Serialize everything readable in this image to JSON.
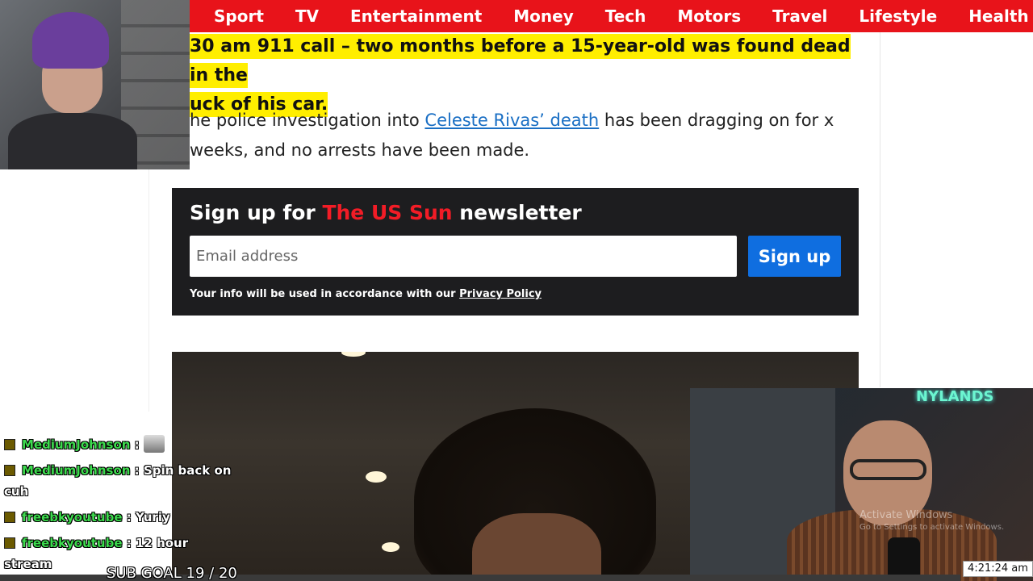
{
  "nav": {
    "items": [
      "Sport",
      "TV",
      "Entertainment",
      "Money",
      "Tech",
      "Motors",
      "Travel",
      "Lifestyle",
      "Health"
    ]
  },
  "article": {
    "highlight_line1": "30 am 911 call – two months before a 15-year-old was found dead in the",
    "highlight_line2": "uck of his car.",
    "para_before": "he police investigation into ",
    "para_link": "Celeste Rivas’ death",
    "para_after": " has been dragging on for x weeks, and no arrests have been made."
  },
  "newsletter": {
    "title_prefix": "Sign up for ",
    "title_brand": "The US Sun",
    "title_suffix": " newsletter",
    "email_placeholder": "Email address",
    "signup_label": "Sign up",
    "info_text": "Your info will be used in accordance with our ",
    "privacy_link": "Privacy Policy",
    "brand_color": "#f21c26",
    "button_color": "#0f6ee0"
  },
  "overlay": {
    "activate_title": "Activate Windows",
    "activate_subtitle": "Go to Settings to activate Windows.",
    "clock": "4:21:24 am",
    "neon_sign": "NYLANDS",
    "sub_goal": "SUB GOAL 19 / 20"
  },
  "chat": {
    "messages": [
      {
        "user": "MediumJohnson",
        "text": "",
        "emote": true
      },
      {
        "user": "MediumJohnson",
        "text": "Spin back on cuh",
        "emote": false
      },
      {
        "user": "freebkyoutube",
        "text": "Yuriy",
        "emote": false
      },
      {
        "user": "freebkyoutube",
        "text": "12 hour stream",
        "emote": false
      }
    ]
  },
  "colors": {
    "nav_red": "#e8131a",
    "highlight_yellow": "#ffee00",
    "link_blue": "#1a6fc4",
    "chat_username": "#3ddc4e"
  }
}
